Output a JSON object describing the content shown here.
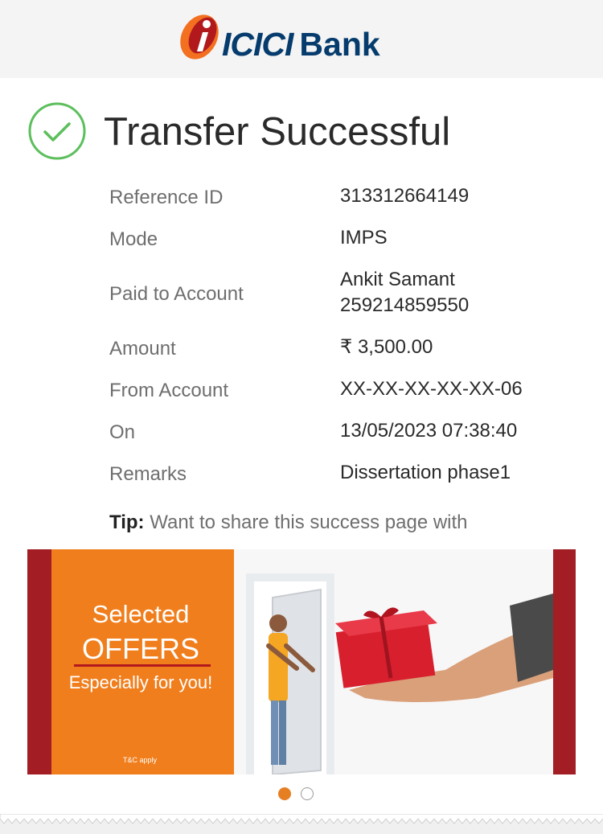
{
  "header": {
    "brand_mark": "i",
    "brand_name": "ICICI",
    "brand_suffix": "Bank",
    "colors": {
      "brand_blue": "#053c6d",
      "brand_orange": "#f37021",
      "brand_red": "#b2191d"
    }
  },
  "status": {
    "icon": "check-circle-icon",
    "title": "Transfer Successful",
    "colors": {
      "success_green": "#5cbf5c"
    }
  },
  "details": [
    {
      "label": "Reference ID",
      "value": "313312664149"
    },
    {
      "label": "Mode",
      "value": "IMPS"
    },
    {
      "label": "Paid to Account",
      "value": "Ankit Samant",
      "value2": "259214859550"
    },
    {
      "label": "Amount",
      "value": "₹ 3,500.00"
    },
    {
      "label": "From Account",
      "value": "XX-XX-XX-XX-XX-06"
    },
    {
      "label": "On",
      "value": "13/05/2023 07:38:40"
    },
    {
      "label": "Remarks",
      "value": "Dissertation phase1"
    }
  ],
  "tip": {
    "prefix": "Tip:",
    "text": "Want to share this success page with"
  },
  "banner": {
    "line1": "Selected",
    "line2": "OFFERS",
    "line3": "Especially for you!",
    "fineprint": "T&C apply",
    "colors": {
      "orange": "#f07e1c",
      "maroon": "#a31d24",
      "gift_red": "#d81f2e"
    }
  },
  "carousel": {
    "total": 2,
    "active": 1
  }
}
